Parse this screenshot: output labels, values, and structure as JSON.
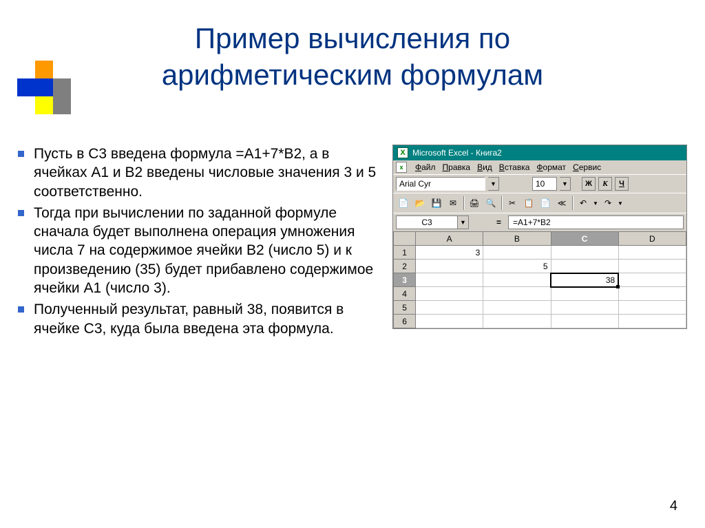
{
  "title_line1": "Пример вычисления по",
  "title_line2": "арифметическим формулам",
  "bullets": [
    "Пусть в С3 введена формула =А1+7*В2, а в ячейках А1 и В2 введены числовые значения 3 и 5 соответственно.",
    "Тогда при вычислении по заданной формуле сначала будет выполнена операция умножения числа 7 на содержимое ячейки В2 (число 5) и к произведению (35) будет прибавлено содержимое ячейки А1 (число 3).",
    "Полученный результат, равный 38, появится в ячейке С3, куда была введена эта формула."
  ],
  "excel": {
    "app_title": "Microsoft Excel - Книга2",
    "menus": [
      "Файл",
      "Правка",
      "Вид",
      "Вставка",
      "Формат",
      "Сервис"
    ],
    "font_name": "Arial Cyr",
    "font_size": "10",
    "style_bold": "Ж",
    "style_italic": "К",
    "style_under": "Ч",
    "active_cell": "C3",
    "formula": "=A1+7*B2",
    "columns": [
      "A",
      "B",
      "C",
      "D"
    ],
    "row_count": 6,
    "cells": {
      "A1": "3",
      "B2": "5",
      "C3": "38"
    },
    "toolbar_icons": [
      "📄",
      "📂",
      "💾",
      "✉",
      "🖨",
      "🔍",
      "✂",
      "📋",
      "📄",
      "≪",
      "↶",
      "↷"
    ]
  },
  "page_number": "4"
}
